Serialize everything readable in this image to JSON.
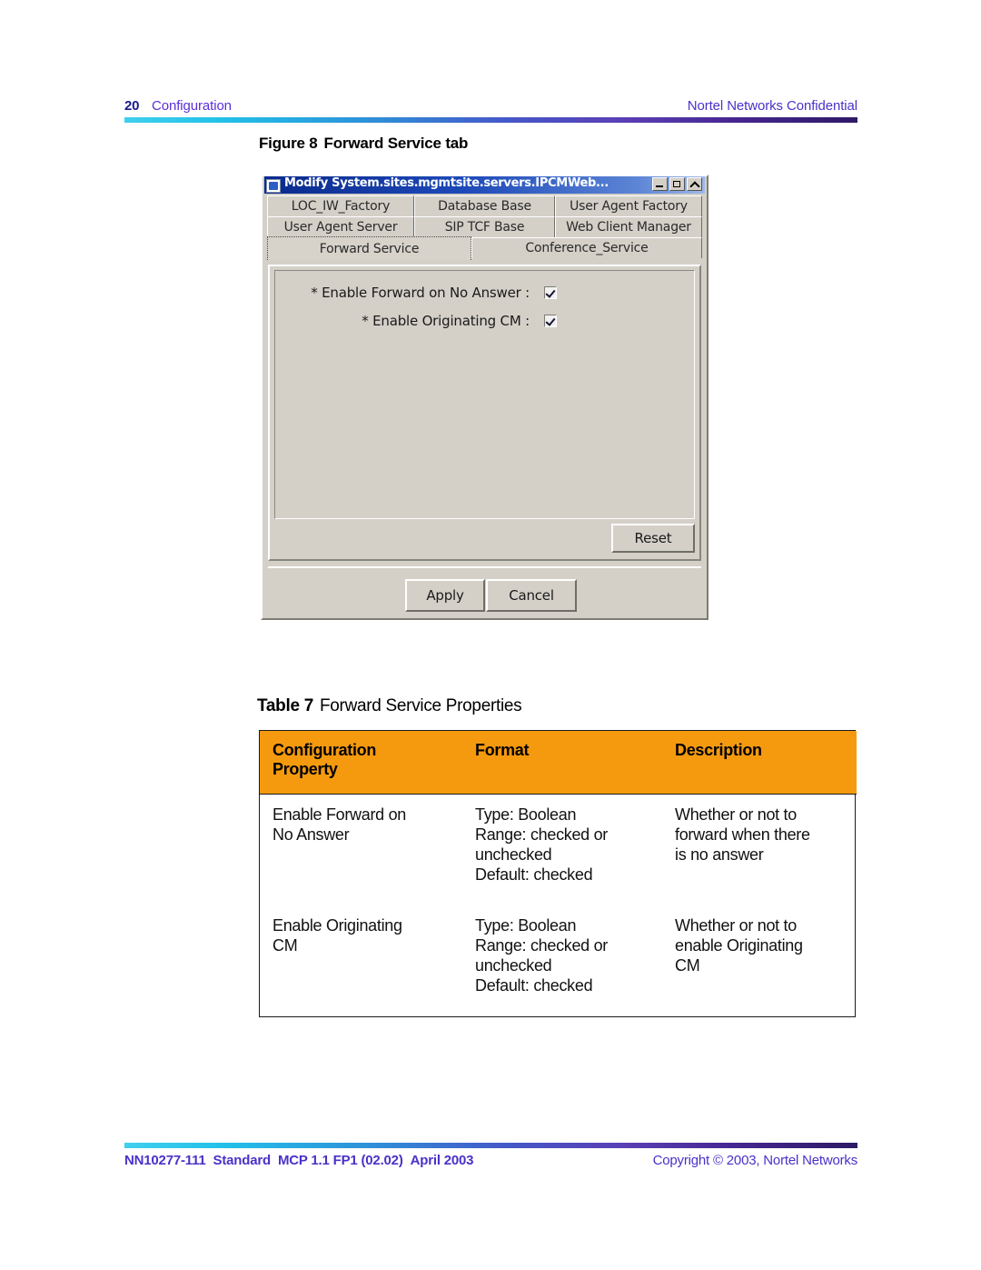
{
  "header": {
    "page_number": "20",
    "chapter": "Configuration",
    "confidential": "Nortel Networks Confidential"
  },
  "figure": {
    "label": "Figure 8",
    "title": "Forward Service tab"
  },
  "dialog": {
    "title": "Modify System.sites.mgmtsite.servers.IPCMWeb...",
    "window_buttons": {
      "minimize": "minimize-button",
      "maximize": "maximize-button",
      "close": "close-button"
    },
    "tab_rows": [
      [
        "LOC_IW_Factory",
        "Database Base",
        "User Agent Factory"
      ],
      [
        "User Agent Server",
        "SIP TCF Base",
        "Web Client Manager"
      ],
      [
        "Forward Service",
        "Conference_Service"
      ]
    ],
    "selected_tab": "Forward Service",
    "fields": [
      {
        "label": "* Enable Forward on No Answer :",
        "checked": true
      },
      {
        "label": "* Enable Originating CM :",
        "checked": true
      }
    ],
    "buttons": {
      "reset": "Reset",
      "apply": "Apply",
      "cancel": "Cancel"
    }
  },
  "table": {
    "caption_label": "Table 7",
    "caption_title": "Forward Service Properties",
    "header_color": "#f59a0f",
    "columns": [
      "Configuration Property",
      "Format",
      "Description"
    ],
    "column_header_lines": [
      [
        "Configuration",
        "Property"
      ],
      [
        "Format"
      ],
      [
        "Description"
      ]
    ],
    "rows": [
      {
        "property": [
          "Enable Forward on",
          "No Answer"
        ],
        "format": [
          "Type: Boolean",
          "Range: checked or",
          "unchecked",
          "Default: checked"
        ],
        "description": [
          "Whether or not to",
          "forward when there",
          "is no answer"
        ]
      },
      {
        "property": [
          "Enable Originating",
          "CM"
        ],
        "format": [
          "Type: Boolean",
          "Range: checked or",
          "unchecked",
          "Default: checked"
        ],
        "description": [
          "Whether or not to",
          "enable Originating",
          "CM"
        ]
      }
    ]
  },
  "footer": {
    "doc_number": "NN10277-111",
    "standard": "Standard",
    "release": "MCP 1.1 FP1 (02.02)",
    "date": "April 2003",
    "copyright": "Copyright © 2003, Nortel Networks"
  }
}
